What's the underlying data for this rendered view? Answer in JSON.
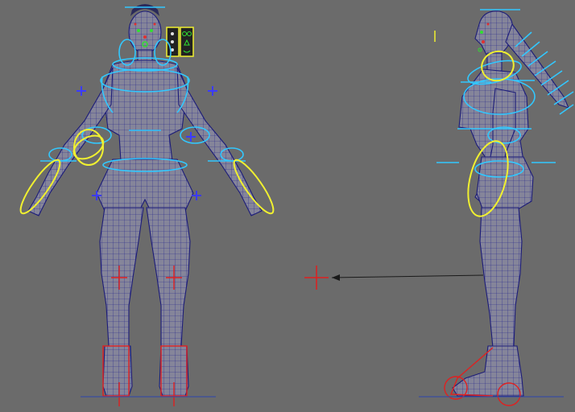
{
  "viewport": {
    "name": "3d-rig-viewport",
    "background": "#6b6b6b",
    "views": [
      "front",
      "side"
    ]
  },
  "colors": {
    "mesh_fill": "#85859a",
    "wireframe": "#23238a",
    "fk_controls": "#32c8ff",
    "ik_controls": "#f0f030",
    "foot_controls": "#e02020",
    "pole_vector": "#3b3bff"
  },
  "icons": {
    "origin_locator": "crosshair-icon",
    "pole_vector": "plus-icon",
    "face_panel": "face-control-panel-icon"
  }
}
